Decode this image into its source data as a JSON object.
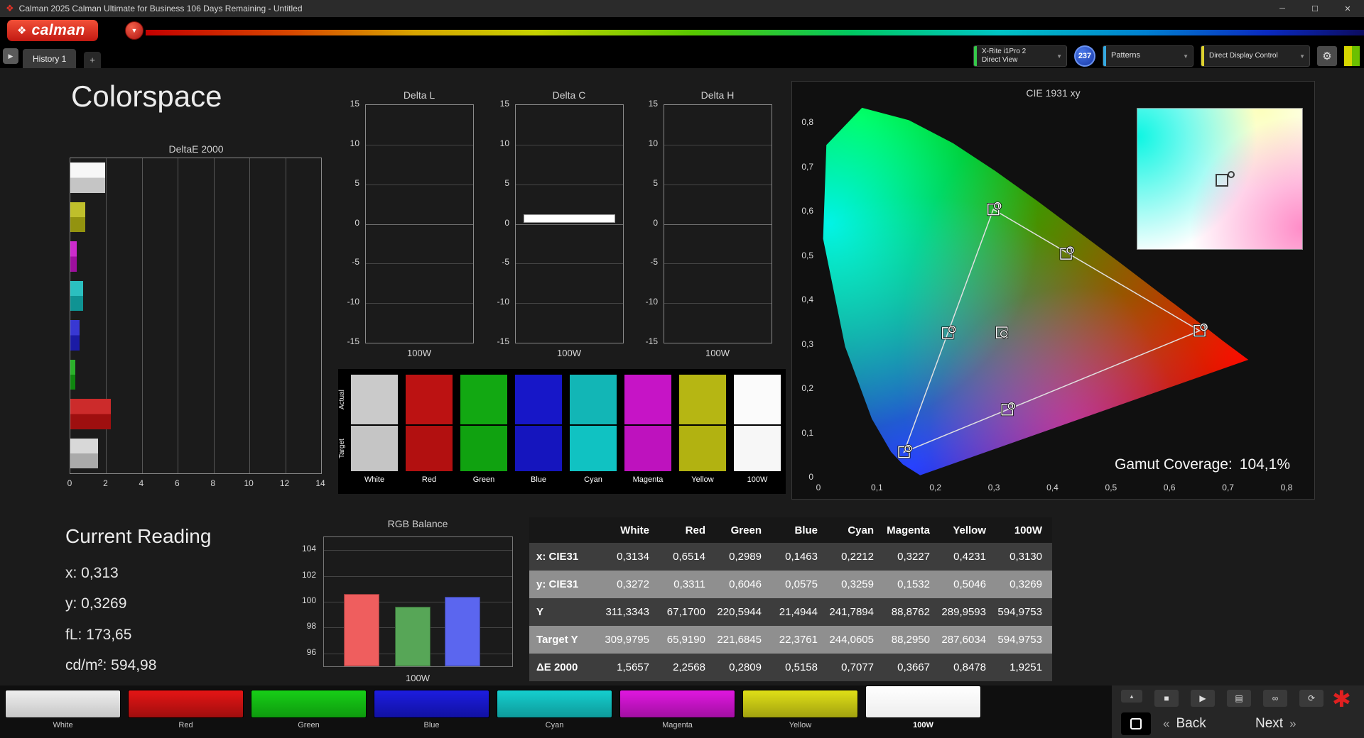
{
  "window": {
    "title": "Calman 2025 Calman Ultimate for Business 106 Days Remaining  - Untitled",
    "icon_mark": "❖",
    "minimize": "─",
    "maximize": "☐",
    "close": "✕"
  },
  "brand": {
    "name": "calman",
    "mark": "❖",
    "arrow": "▼"
  },
  "tab_bar": {
    "panel_toggle": "▶",
    "history_tab": "History 1",
    "add_tab": "+"
  },
  "toolbar": {
    "meter_dropdown": {
      "line1": "X-Rite i1Pro 2",
      "line2": "Direct View",
      "accent": "#35c94a"
    },
    "counter_badge": "237",
    "patterns_dropdown": {
      "label": "Patterns",
      "accent": "#35a9e0"
    },
    "display_control_dropdown": {
      "label": "Direct Display Control",
      "accent": "#ded32e"
    },
    "caret": "▼",
    "gear_icon": "⚙"
  },
  "page": {
    "title": "Colorspace"
  },
  "current_reading": {
    "title": "Current Reading",
    "lines": [
      "x: 0,313",
      "y: 0,3269",
      "fL: 173,65",
      "cd/m²: 594,98"
    ]
  },
  "swatch_panel": {
    "row_labels": [
      "Actual",
      "Target"
    ],
    "columns": [
      {
        "label": "White",
        "actual": "#cacaca",
        "target": "#c5c5c5"
      },
      {
        "label": "Red",
        "actual": "#bc1212",
        "target": "#b21010"
      },
      {
        "label": "Green",
        "actual": "#12a812",
        "target": "#10a210"
      },
      {
        "label": "Blue",
        "actual": "#1717c8",
        "target": "#1515be"
      },
      {
        "label": "Cyan",
        "actual": "#12b6b6",
        "target": "#10c2c2"
      },
      {
        "label": "Magenta",
        "actual": "#c614c6",
        "target": "#be12be"
      },
      {
        "label": "Yellow",
        "actual": "#b6b613",
        "target": "#b2b211"
      },
      {
        "label": "100W",
        "actual": "#fbfbfb",
        "target": "#f7f7f7"
      }
    ]
  },
  "bottom_bar": {
    "patch_buttons": [
      {
        "label": "White",
        "top": "#efefef",
        "bottom": "#c6c6c6",
        "selected": false
      },
      {
        "label": "Red",
        "top": "#e51515",
        "bottom": "#a00e0e",
        "selected": false
      },
      {
        "label": "Green",
        "top": "#17cf17",
        "bottom": "#0e9a0e",
        "selected": false
      },
      {
        "label": "Blue",
        "top": "#1d1de0",
        "bottom": "#1111a2",
        "selected": false
      },
      {
        "label": "Cyan",
        "top": "#15cfcf",
        "bottom": "#0e9a9a",
        "selected": false
      },
      {
        "label": "Magenta",
        "top": "#e017e0",
        "bottom": "#a20fa2",
        "selected": false
      },
      {
        "label": "Yellow",
        "top": "#e0e017",
        "bottom": "#a2a20f",
        "selected": false
      },
      {
        "label": "100W",
        "top": "#ffffff",
        "bottom": "#ededed",
        "selected": true
      }
    ],
    "scroll_up": "▲",
    "icons": [
      {
        "name": "stop",
        "glyph": "■"
      },
      {
        "name": "play",
        "glyph": "▶"
      },
      {
        "name": "report",
        "glyph": "▤"
      },
      {
        "name": "link",
        "glyph": "∞"
      },
      {
        "name": "refresh",
        "glyph": "⟳"
      }
    ],
    "back_chevron": "«",
    "back_label": "Back",
    "next_label": "Next",
    "next_chevron": "»",
    "brand_asterisk": "✱"
  },
  "chart_data": [
    {
      "id": "deltae2000",
      "type": "bar",
      "orientation": "horizontal",
      "title": "DeltaE 2000",
      "categories": [
        "100W",
        "Yellow",
        "Magenta",
        "Cyan",
        "Blue",
        "Green",
        "Red",
        "White"
      ],
      "values": [
        1.9251,
        0.8478,
        0.3667,
        0.7077,
        0.5158,
        0.2809,
        2.2568,
        1.5657
      ],
      "colors": [
        "#f6f6f6",
        "#b8b813",
        "#c613c6",
        "#13b8b8",
        "#2222ce",
        "#13a813",
        "#c61313",
        "#d4d4d4"
      ],
      "xlim": [
        0,
        14
      ],
      "x_ticks": [
        "0",
        "2",
        "4",
        "6",
        "8",
        "10",
        "12",
        "14"
      ]
    },
    {
      "id": "delta_l",
      "type": "bar",
      "title": "Delta L",
      "categories": [
        "100W"
      ],
      "values": [
        0
      ],
      "ylim": [
        -15,
        15
      ],
      "y_ticks": [
        "15",
        "10",
        "5",
        "0",
        "-5",
        "-10",
        "-15"
      ],
      "xlabel": "100W"
    },
    {
      "id": "delta_c",
      "type": "bar",
      "title": "Delta C",
      "categories": [
        "100W"
      ],
      "values": [
        0.7
      ],
      "bar": {
        "from": 0.1,
        "to": 1.25
      },
      "ylim": [
        -15,
        15
      ],
      "y_ticks": [
        "15",
        "10",
        "5",
        "0",
        "-5",
        "-10",
        "-15"
      ],
      "xlabel": "100W"
    },
    {
      "id": "delta_h",
      "type": "bar",
      "title": "Delta H",
      "categories": [
        "100W"
      ],
      "values": [
        0
      ],
      "ylim": [
        -15,
        15
      ],
      "y_ticks": [
        "15",
        "10",
        "5",
        "0",
        "-5",
        "-10",
        "-15"
      ],
      "xlabel": "100W"
    },
    {
      "id": "rgb_balance",
      "type": "bar",
      "title": "RGB Balance",
      "categories": [
        "Red",
        "Green",
        "Blue"
      ],
      "values": [
        100.6,
        99.6,
        100.4
      ],
      "colors": [
        "#ef5e5e",
        "#57a657",
        "#5b66ef"
      ],
      "ylim": [
        95,
        105
      ],
      "grid_values": [
        104,
        102,
        100,
        98,
        96
      ],
      "y_ticks": [
        "104",
        "102",
        "100",
        "98",
        "96"
      ],
      "xlabel": "100W"
    },
    {
      "id": "cie1931",
      "type": "scatter",
      "title": "CIE 1931 xy",
      "xlim": [
        0,
        0.8
      ],
      "ylim": [
        0,
        0.8
      ],
      "x_ticks": [
        "0",
        "0,1",
        "0,2",
        "0,3",
        "0,4",
        "0,5",
        "0,6",
        "0,7",
        "0,8"
      ],
      "y_ticks": [
        "0",
        "0,1",
        "0,2",
        "0,3",
        "0,4",
        "0,5",
        "0,6",
        "0,7",
        "0,8"
      ],
      "triangle": [
        [
          0.6514,
          0.3311
        ],
        [
          0.2989,
          0.6046
        ],
        [
          0.1463,
          0.0575
        ]
      ],
      "points": [
        {
          "name": "White",
          "x": 0.3134,
          "y": 0.3272
        },
        {
          "name": "Red",
          "x": 0.6514,
          "y": 0.3311
        },
        {
          "name": "Green",
          "x": 0.2989,
          "y": 0.6046
        },
        {
          "name": "Blue",
          "x": 0.1463,
          "y": 0.0575
        },
        {
          "name": "Cyan",
          "x": 0.2212,
          "y": 0.3259
        },
        {
          "name": "Magenta",
          "x": 0.3227,
          "y": 0.1532
        },
        {
          "name": "Yellow",
          "x": 0.4231,
          "y": 0.5046
        }
      ],
      "gamut_label": "Gamut Coverage:",
      "gamut_value": "104,1%"
    },
    {
      "id": "measurement_table",
      "type": "table",
      "columns": [
        "",
        "White",
        "Red",
        "Green",
        "Blue",
        "Cyan",
        "Magenta",
        "Yellow",
        "100W"
      ],
      "rows": [
        {
          "label": "x: CIE31",
          "values": [
            "0,3134",
            "0,6514",
            "0,2989",
            "0,1463",
            "0,2212",
            "0,3227",
            "0,4231",
            "0,3130"
          ]
        },
        {
          "label": "y: CIE31",
          "values": [
            "0,3272",
            "0,3311",
            "0,6046",
            "0,0575",
            "0,3259",
            "0,1532",
            "0,5046",
            "0,3269"
          ]
        },
        {
          "label": "Y",
          "values": [
            "311,3343",
            "67,1700",
            "220,5944",
            "21,4944",
            "241,7894",
            "88,8762",
            "289,9593",
            "594,9753"
          ]
        },
        {
          "label": "Target Y",
          "values": [
            "309,9795",
            "65,9190",
            "221,6845",
            "22,3761",
            "244,0605",
            "88,2950",
            "287,6034",
            "594,9753"
          ]
        },
        {
          "label": "ΔE 2000",
          "values": [
            "1,5657",
            "2,2568",
            "0,2809",
            "0,5158",
            "0,7077",
            "0,3667",
            "0,8478",
            "1,9251"
          ]
        }
      ]
    }
  ]
}
